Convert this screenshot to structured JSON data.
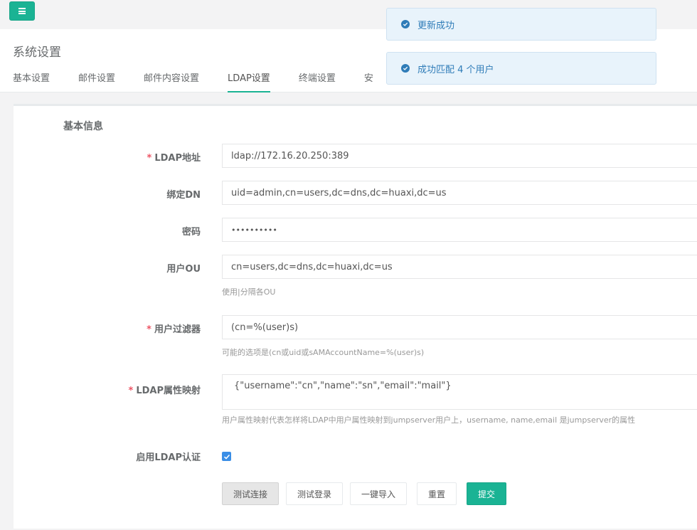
{
  "header": {
    "page_title": "系统设置",
    "tabs": [
      {
        "label": "基本设置"
      },
      {
        "label": "邮件设置"
      },
      {
        "label": "邮件内容设置"
      },
      {
        "label": "LDAP设置"
      },
      {
        "label": "终端设置"
      },
      {
        "label": "安"
      }
    ],
    "active_tab": "LDAP设置"
  },
  "toasts": [
    {
      "text": "更新成功"
    },
    {
      "text": "成功匹配 4 个用户"
    }
  ],
  "form": {
    "section_title": "基本信息",
    "required_mark": "*",
    "fields": {
      "ldap_address": {
        "label": "LDAP地址",
        "value": "ldap://172.16.20.250:389"
      },
      "bind_dn": {
        "label": "绑定DN",
        "value": "uid=admin,cn=users,dc=dns,dc=huaxi,dc=us"
      },
      "password": {
        "label": "密码",
        "value": "••••••••••"
      },
      "user_ou": {
        "label": "用户OU",
        "value": "cn=users,dc=dns,dc=huaxi,dc=us",
        "help": "使用|分隔各OU"
      },
      "user_filter": {
        "label": "用户过滤器",
        "value": "(cn=%(user)s)",
        "help": "可能的选项是(cn或uid或sAMAccountName=%(user)s)"
      },
      "attr_map": {
        "label": "LDAP属性映射",
        "value": "{\"username\":\"cn\",\"name\":\"sn\",\"email\":\"mail\"}",
        "help": "用户属性映射代表怎样将LDAP中用户属性映射到jumpserver用户上，username, name,email 是jumpserver的属性"
      },
      "enable_auth": {
        "label": "启用LDAP认证",
        "checked": true
      }
    },
    "buttons": {
      "test_connection": "测试连接",
      "test_login": "测试登录",
      "import": "一键导入",
      "reset": "重置",
      "submit": "提交"
    }
  },
  "colors": {
    "accent": "#1ab394",
    "required": "#ed5565",
    "toast_bg": "#e8f3fb",
    "toast_text": "#2f7cb8",
    "checkbox": "#3a8ee6"
  }
}
